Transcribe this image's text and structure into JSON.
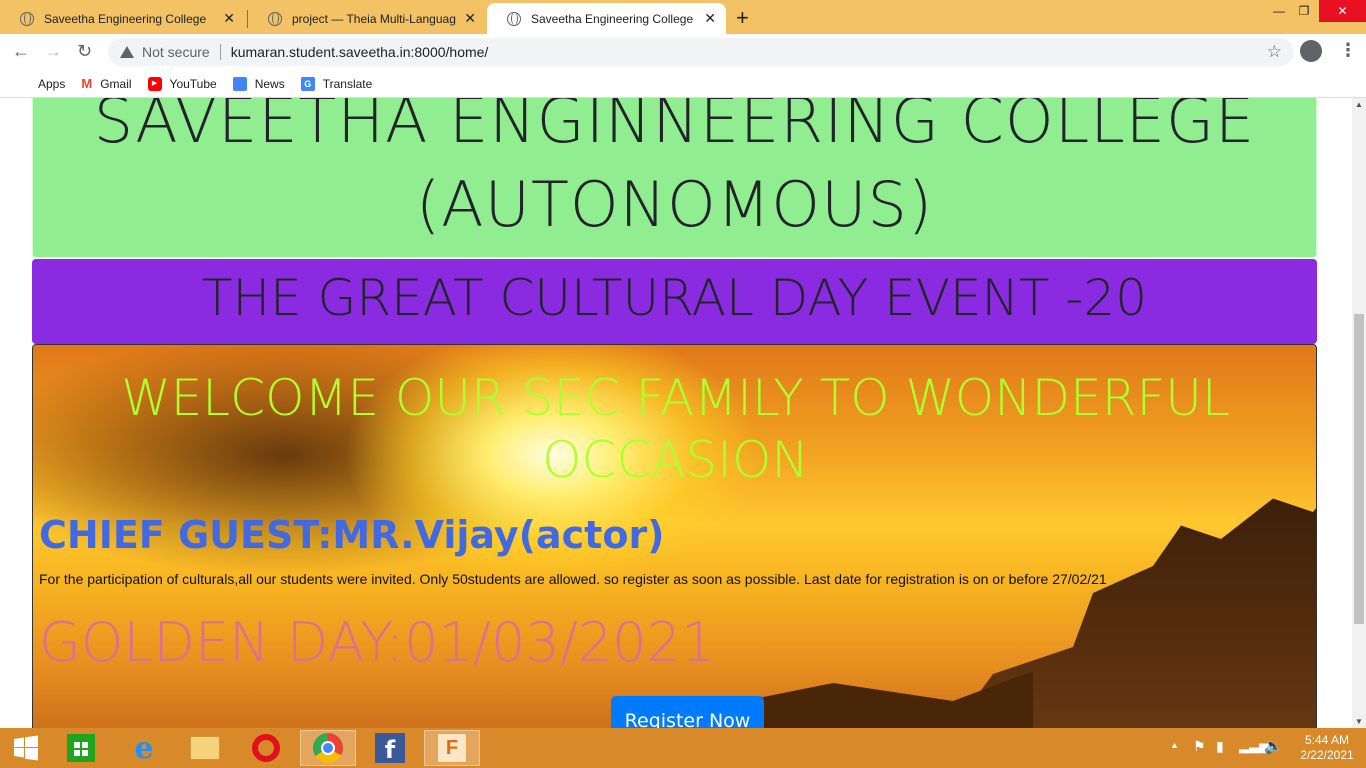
{
  "browser": {
    "tabs": [
      {
        "title": "Saveetha Engineering College",
        "active": false
      },
      {
        "title": "project — Theia Multi-Language",
        "active": false
      },
      {
        "title": "Saveetha Engineering College",
        "active": true
      }
    ],
    "new_tab_icon": "+",
    "address": {
      "security_text": "Not secure",
      "url": "kumaran.student.saveetha.in:8000/home/"
    },
    "bookmarks": [
      {
        "label": "Apps",
        "icon": "apps-grid-icon"
      },
      {
        "label": "Gmail",
        "icon": "gmail-icon"
      },
      {
        "label": "YouTube",
        "icon": "youtube-icon"
      },
      {
        "label": "News",
        "icon": "news-icon"
      },
      {
        "label": "Translate",
        "icon": "translate-icon"
      }
    ]
  },
  "page": {
    "header_line1": "SAVEETHA ENGINNEERING COLLEGE",
    "header_line2": "(AUTONOMOUS)",
    "event_title": "THE GREAT CULTURAL DAY EVENT -20",
    "welcome": "WELCOME OUR SEC FAMILY TO WONDERFUL OCCASION",
    "chief_guest": "CHIEF GUEST:MR.Vijay(actor)",
    "description": "For the participation of culturals,all our students were invited. Only 50students are allowed. so register as soon as possible. Last date for registration is on or before 27/02/21",
    "golden_day": "GOLDEN DAY:01/03/2021",
    "register_button": "Register Now"
  },
  "colors": {
    "header_bg": "#90ee90",
    "event_bg": "#8a2be2",
    "welcome_text": "#adff2f",
    "chief_text": "#4169e1",
    "golden_text": "#db7093",
    "button_bg": "#007bff",
    "taskbar_bg": "#d8892a",
    "titlebar_bg": "#f2c264"
  },
  "taskbar": {
    "apps": [
      "windows-start-icon",
      "store-icon",
      "internet-explorer-icon",
      "file-explorer-icon",
      "opera-icon",
      "chrome-icon",
      "facebook-icon",
      "fusion360-icon"
    ],
    "time": "5:44 AM",
    "date": "2/22/2021"
  }
}
